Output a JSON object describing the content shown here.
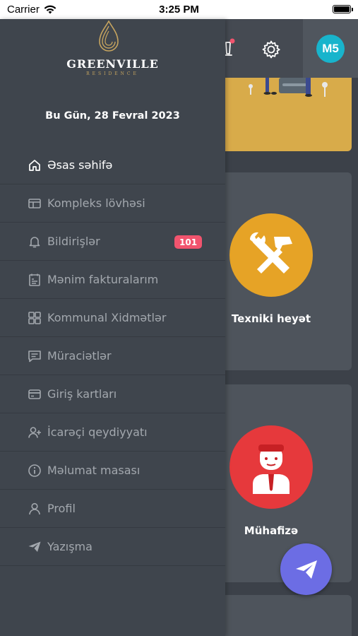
{
  "status_bar": {
    "carrier": "Carrier",
    "time": "3:25 PM"
  },
  "header": {
    "avatar_initials": "M5"
  },
  "cards": [
    {
      "label": "Texniki heyət",
      "icon": "tools-icon"
    },
    {
      "label": "Mühafizə",
      "icon": "security-guard-icon"
    }
  ],
  "drawer": {
    "logo": {
      "brand": "GREENVILLE",
      "sub": "RESIDENCE"
    },
    "date": "Bu Gün, 28 Fevral 2023",
    "items": [
      {
        "label": "Əsas səhifə",
        "icon": "home-icon",
        "active": true
      },
      {
        "label": "Kompleks lövhəsi",
        "icon": "board-icon"
      },
      {
        "label": "Bildirişlər",
        "icon": "bell-icon",
        "badge": "101"
      },
      {
        "label": "Mənim fakturalarım",
        "icon": "invoice-icon"
      },
      {
        "label": "Kommunal Xidmətlər",
        "icon": "utilities-icon"
      },
      {
        "label": "Müraciətlər",
        "icon": "message-icon"
      },
      {
        "label": "Giriş kartları",
        "icon": "card-icon"
      },
      {
        "label": "İcarəçi qeydiyyatı",
        "icon": "add-user-icon"
      },
      {
        "label": "Məlumat masası",
        "icon": "info-icon"
      },
      {
        "label": "Profil",
        "icon": "user-icon"
      },
      {
        "label": "Yazışma",
        "icon": "send-icon"
      }
    ]
  },
  "colors": {
    "drawer_bg": "#3f454d",
    "badge": "#f1546e",
    "avatar": "#18b4cc",
    "fab": "#6c6de4",
    "tools_circle": "#e6a326",
    "guard_circle": "#e6393c"
  }
}
